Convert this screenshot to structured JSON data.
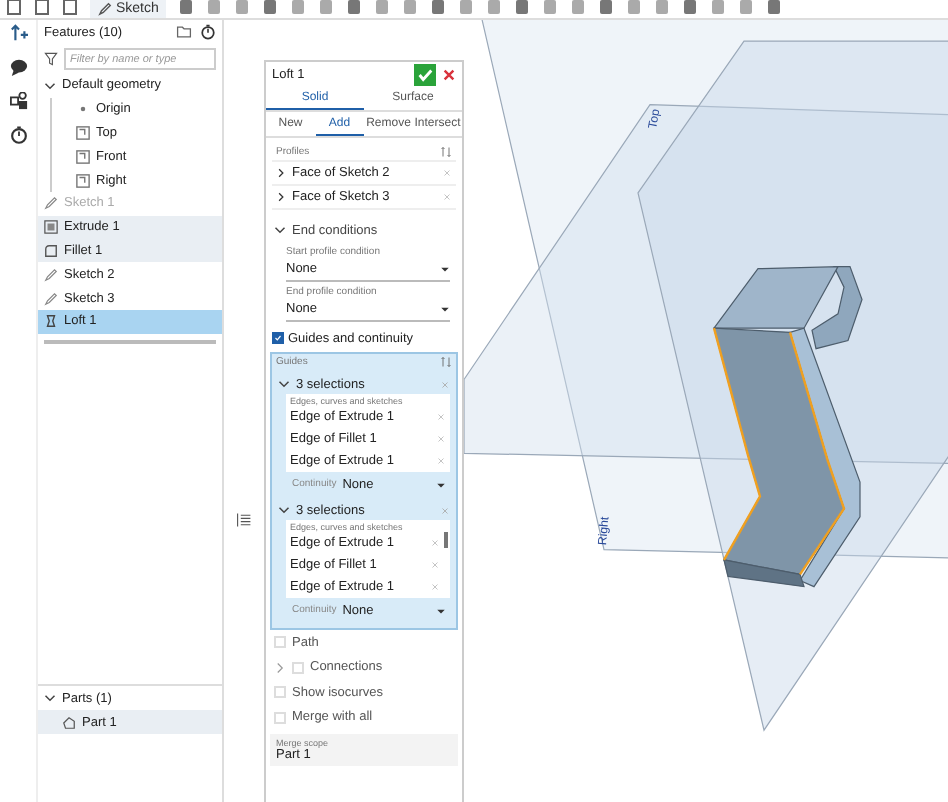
{
  "toolbar": {
    "sketch_button": "Sketch"
  },
  "feature_panel": {
    "title": "Features (10)",
    "filter": {
      "placeholder": "Filter by name or type"
    },
    "default_geometry": {
      "label": "Default geometry",
      "expanded": true,
      "children": [
        {
          "label": "Origin",
          "kind": "point"
        },
        {
          "label": "Top",
          "kind": "plane"
        },
        {
          "label": "Front",
          "kind": "plane"
        },
        {
          "label": "Right",
          "kind": "plane"
        }
      ]
    },
    "features": [
      {
        "label": "Sketch 1",
        "kind": "sketch",
        "disabled": true,
        "highlighted": false,
        "selected": false
      },
      {
        "label": "Extrude 1",
        "kind": "extrude",
        "disabled": false,
        "highlighted": true,
        "selected": false
      },
      {
        "label": "Fillet 1",
        "kind": "fillet",
        "disabled": false,
        "highlighted": true,
        "selected": false
      },
      {
        "label": "Sketch 2",
        "kind": "sketch",
        "disabled": false,
        "highlighted": false,
        "selected": false
      },
      {
        "label": "Sketch 3",
        "kind": "sketch",
        "disabled": false,
        "highlighted": false,
        "selected": false
      },
      {
        "label": "Loft 1",
        "kind": "loft",
        "disabled": false,
        "highlighted": false,
        "selected": true
      }
    ],
    "parts": {
      "label": "Parts (1)",
      "expanded": true,
      "items": [
        {
          "label": "Part 1"
        }
      ]
    }
  },
  "loft": {
    "title": "Loft 1",
    "type_tabs": [
      {
        "label": "Solid",
        "selected": true
      },
      {
        "label": "Surface",
        "selected": false
      }
    ],
    "op_tabs": [
      {
        "label": "New",
        "selected": false
      },
      {
        "label": "Add",
        "selected": true
      },
      {
        "label": "Remove",
        "selected": false
      },
      {
        "label": "Intersect",
        "selected": false
      }
    ],
    "profiles": {
      "label": "Profiles",
      "items": [
        "Face of Sketch 2",
        "Face of Sketch 3"
      ]
    },
    "end_conditions": {
      "label": "End conditions",
      "expanded": true,
      "start_label": "Start profile condition",
      "start_value": "None",
      "end_label": "End profile condition",
      "end_value": "None"
    },
    "guides_checkbox": {
      "label": "Guides and continuity",
      "checked": true
    },
    "guides": {
      "label": "Guides",
      "groups": [
        {
          "label": "3 selections",
          "expanded": true,
          "list_label": "Edges, curves and sketches",
          "items": [
            "Edge of Extrude 1",
            "Edge of Fillet 1",
            "Edge of Extrude 1"
          ],
          "continuity_label": "Continuity",
          "continuity": "None"
        },
        {
          "label": "3 selections",
          "expanded": true,
          "list_label": "Edges, curves and sketches",
          "items": [
            "Edge of Extrude 1",
            "Edge of Fillet 1",
            "Edge of Extrude 1"
          ],
          "continuity_label": "Continuity",
          "continuity": "None"
        }
      ]
    },
    "options": [
      {
        "label": "Path",
        "kind": "checkbox",
        "checked": false
      },
      {
        "label": "Connections",
        "kind": "expander",
        "checked": false
      },
      {
        "label": "Show isocurves",
        "kind": "checkbox",
        "checked": false
      },
      {
        "label": "Merge with all",
        "kind": "checkbox",
        "checked": false
      }
    ],
    "merge_scope": {
      "label": "Merge scope",
      "value": "Part 1"
    }
  },
  "viewport": {
    "plane_labels": [
      "Top",
      "Right"
    ]
  }
}
